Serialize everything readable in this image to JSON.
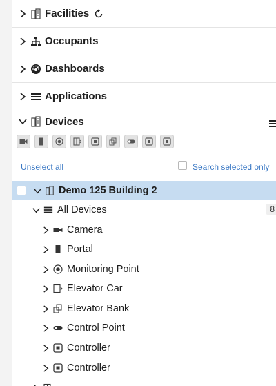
{
  "sections": [
    {
      "label": "Facilities",
      "icon": "building-icon"
    },
    {
      "label": "Occupants",
      "icon": "org-chart-icon"
    },
    {
      "label": "Dashboards",
      "icon": "gauge-icon"
    },
    {
      "label": "Applications",
      "icon": "list-icon"
    },
    {
      "label": "Devices",
      "icon": "building-icon"
    }
  ],
  "device_filters": [
    "camera-icon",
    "portal-icon",
    "monitoring-point-icon",
    "elevator-car-icon",
    "controller-icon",
    "elevator-bank-icon",
    "control-point-icon",
    "controller-icon",
    "controller-icon"
  ],
  "actions": {
    "unselect_all": "Unselect all",
    "search_selected_only": "Search selected only"
  },
  "tree": {
    "building": "Demo 125 Building 2",
    "all_devices": "All Devices",
    "all_devices_count": "8",
    "items": [
      {
        "label": "Camera",
        "icon": "camera-icon"
      },
      {
        "label": "Portal",
        "icon": "portal-icon"
      },
      {
        "label": "Monitoring Point",
        "icon": "monitoring-point-icon"
      },
      {
        "label": "Elevator Car",
        "icon": "elevator-car-icon"
      },
      {
        "label": "Elevator Bank",
        "icon": "elevator-bank-icon"
      },
      {
        "label": "Control Point",
        "icon": "control-point-icon"
      },
      {
        "label": "Controller",
        "icon": "controller-icon"
      },
      {
        "label": "Controller",
        "icon": "controller-icon"
      }
    ]
  },
  "colors": {
    "link": "#3a78c4",
    "selected_row": "#c6dcf1",
    "toolbar_button": "#e3e3e3"
  }
}
